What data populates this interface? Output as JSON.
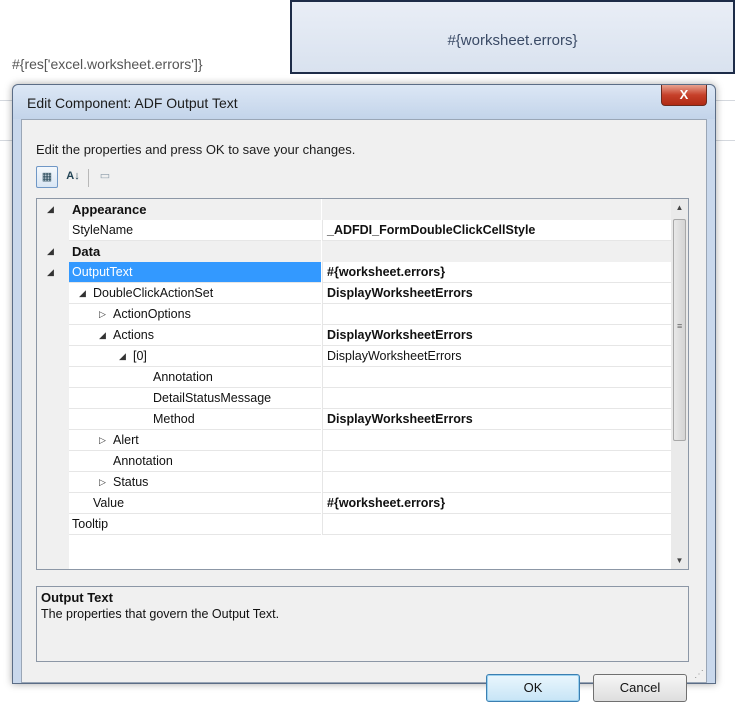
{
  "background": {
    "left_cell": "#{res['excel.worksheet.errors']}",
    "right_cell": "#{worksheet.errors}"
  },
  "dialog": {
    "title": "Edit Component: ADF Output Text",
    "close_label": "X",
    "instructions": "Edit the properties and press OK to save your changes.",
    "toolbar": {
      "categorized_icon": "categorized-view-icon",
      "alphabetical_icon": "alphabetical-sort-icon",
      "property_pages_icon": "property-pages-icon",
      "alphabetical_glyph": "A↓",
      "categorized_glyph": "▦",
      "pages_glyph": "▭"
    },
    "grid": {
      "rows": [
        {
          "name": "Appearance",
          "value": "",
          "category": true,
          "expander": "◢"
        },
        {
          "name": "StyleName",
          "value": "_ADFDI_FormDoubleClickCellStyle",
          "bold": true
        },
        {
          "name": "Data",
          "value": "",
          "category": true,
          "expander": "◢"
        },
        {
          "name": "OutputText",
          "value": "#{worksheet.errors}",
          "bold": true,
          "selected": true,
          "expander": "◢"
        },
        {
          "name": "DoubleClickActionSet",
          "value": "DisplayWorksheetErrors",
          "bold": true,
          "expander": "◢"
        },
        {
          "name": "ActionOptions",
          "value": "",
          "expander": "▷"
        },
        {
          "name": "Actions",
          "value": "DisplayWorksheetErrors",
          "bold": true,
          "expander": "◢"
        },
        {
          "name": "[0]",
          "value": "DisplayWorksheetErrors",
          "expander": "◢"
        },
        {
          "name": "Annotation",
          "value": ""
        },
        {
          "name": "DetailStatusMessage",
          "value": ""
        },
        {
          "name": "Method",
          "value": "DisplayWorksheetErrors",
          "bold": true
        },
        {
          "name": "Alert",
          "value": "",
          "expander": "▷"
        },
        {
          "name": "Annotation",
          "value": ""
        },
        {
          "name": "Status",
          "value": "",
          "expander": "▷"
        },
        {
          "name": "Value",
          "value": "#{worksheet.errors}",
          "bold": true
        },
        {
          "name": "Tooltip",
          "value": ""
        }
      ],
      "scroll_up": "▲",
      "scroll_down": "▼",
      "scroll_grip": "≡"
    },
    "description": {
      "title": "Output Text",
      "body": "The properties that govern the Output Text."
    },
    "buttons": {
      "ok": "OK",
      "cancel": "Cancel"
    },
    "resize_grip": "⋰"
  }
}
